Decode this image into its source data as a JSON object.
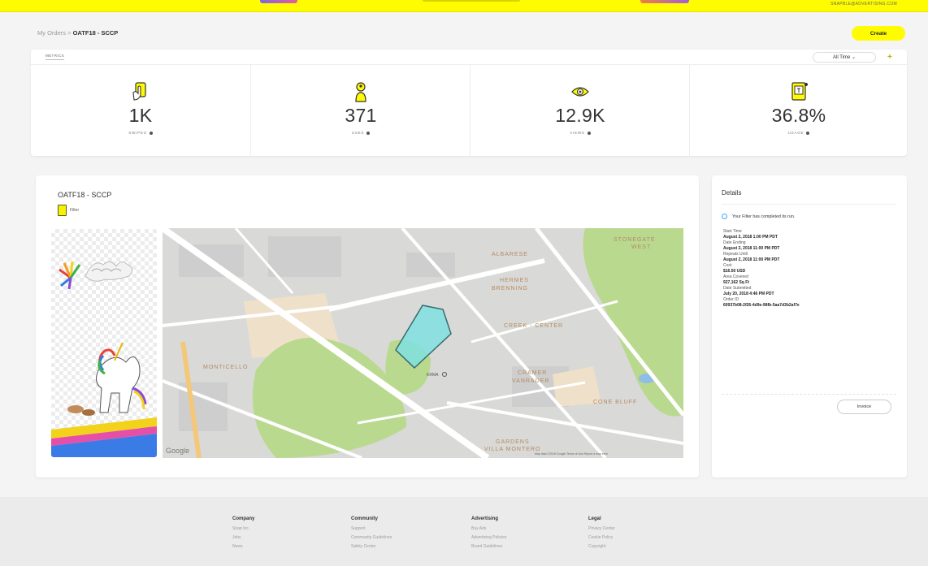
{
  "top_bar": {
    "account_text": "SNAPBLE@ADVERTISING.COM"
  },
  "breadcrumb": {
    "parent": "My Orders",
    "separator": ">",
    "current": "OATF18 - SCCP"
  },
  "create_button": {
    "label": "Create"
  },
  "metrics": {
    "tab_label": "METRICS",
    "range_select": "All Time ⌄",
    "add_icon": "plus-icon",
    "items": [
      {
        "icon": "swipe-hand-icon",
        "value": "1K",
        "label": "SWIPES"
      },
      {
        "icon": "user-touch-icon",
        "value": "371",
        "label": "USES"
      },
      {
        "icon": "eye-icon",
        "value": "12.9K",
        "label": "VIEWS"
      },
      {
        "icon": "filter-usage-icon",
        "value": "36.8%",
        "label": "USAGE"
      }
    ]
  },
  "order": {
    "title": "OATF18 - SCCP",
    "type_label": "Filter",
    "map_labels": {
      "stonegate": "STONEGATE",
      "stonegate_west": "WEST",
      "albarese": "ALBARESE",
      "hermes": "HERMES",
      "brenning": "BRENNING",
      "creek_center": "CREEK - CENTER",
      "monticello": "MONTICELLO",
      "cramer": "CRAMER",
      "vanrader": "VANRADER",
      "cone_bluff": "CONE BLUFF",
      "gardens": "GARDENS",
      "villa_montero": "VILLA MONTERO",
      "map_place": "KRMA",
      "google": "Google",
      "attribution": "Map data ©2018 Google   Terms of Use   Report a map error"
    }
  },
  "details": {
    "title": "Details",
    "status": "Your Filter has completed its run.",
    "items": [
      {
        "label": "Start Time",
        "value": "August 2, 2018 1:00 PM PDT"
      },
      {
        "label": "Date Ending",
        "value": "August 2, 2018 11:00 PM PDT"
      },
      {
        "label": "Repeats Until",
        "value": "August 2, 2018 11:00 PM PDT"
      },
      {
        "label": "Cost",
        "value": "$16.50 USD"
      },
      {
        "label": "Area Covered",
        "value": "927,162 Sq Ft"
      },
      {
        "label": "Date Submitted",
        "value": "July 20, 2018 4:46 PM PDT"
      },
      {
        "label": "Order ID",
        "value": "60937b08-2f26-4d9e-98fb-5aa7d3b2af7e"
      }
    ],
    "invoice_button": "Invoice"
  },
  "footer": {
    "columns": [
      {
        "heading": "Company",
        "links": [
          "Snap Inc.",
          "Jobs",
          "News"
        ]
      },
      {
        "heading": "Community",
        "links": [
          "Support",
          "Community Guidelines",
          "Safety Center"
        ]
      },
      {
        "heading": "Advertising",
        "links": [
          "Buy Ads",
          "Advertising Policies",
          "Brand Guidelines"
        ]
      },
      {
        "heading": "Legal",
        "links": [
          "Privacy Center",
          "Cookie Policy",
          "Copyright"
        ]
      }
    ]
  },
  "colors": {
    "brand_yellow": "#fffc00",
    "geofence": "#7fe0e0",
    "park_green": "#b8d88c"
  }
}
